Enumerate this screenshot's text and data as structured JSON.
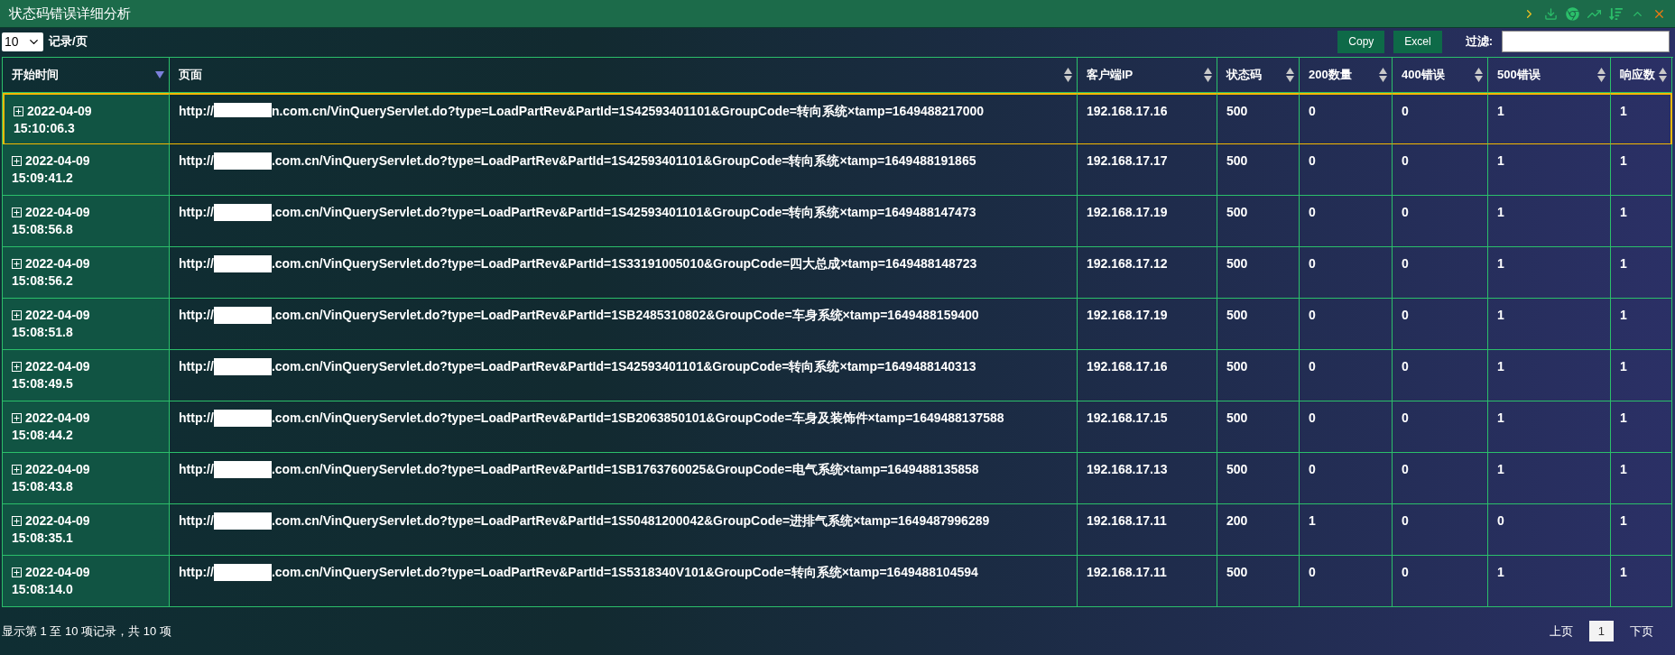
{
  "window": {
    "title": "状态码错误详细分析"
  },
  "toolbar": {
    "page_size": "10",
    "page_size_label": "记录/页",
    "buttons": [
      "Copy",
      "Excel"
    ],
    "filter_label": "过滤:"
  },
  "table": {
    "columns": [
      {
        "label": "开始时间",
        "sorted": true
      },
      {
        "label": "页面",
        "sorted": false
      },
      {
        "label": "客户端IP",
        "sorted": false
      },
      {
        "label": "状态码",
        "sorted": false
      },
      {
        "label": "200数量",
        "sorted": false
      },
      {
        "label": "400错误",
        "sorted": false
      },
      {
        "label": "500错误",
        "sorted": false
      },
      {
        "label": "响应数",
        "sorted": false
      }
    ],
    "rows": [
      {
        "selected": true,
        "date": "2022-04-09",
        "time": "15:10:06.3",
        "page_start": "http://",
        "page_end": "n.com.cn/VinQueryServlet.do?type=LoadPartRev&PartId=1S42593401101&GroupCode=转向系统×tamp=1649488217000",
        "ip": "192.168.17.16",
        "status": "500",
        "c200": "0",
        "c400": "0",
        "c500": "1",
        "resp": "1"
      },
      {
        "selected": false,
        "date": "2022-04-09",
        "time": "15:09:41.2",
        "page_start": "http://",
        "page_end": ".com.cn/VinQueryServlet.do?type=LoadPartRev&PartId=1S42593401101&GroupCode=转向系统×tamp=1649488191865",
        "ip": "192.168.17.17",
        "status": "500",
        "c200": "0",
        "c400": "0",
        "c500": "1",
        "resp": "1"
      },
      {
        "selected": false,
        "date": "2022-04-09",
        "time": "15:08:56.8",
        "page_start": "http://",
        "page_end": ".com.cn/VinQueryServlet.do?type=LoadPartRev&PartId=1S42593401101&GroupCode=转向系统×tamp=1649488147473",
        "ip": "192.168.17.19",
        "status": "500",
        "c200": "0",
        "c400": "0",
        "c500": "1",
        "resp": "1"
      },
      {
        "selected": false,
        "date": "2022-04-09",
        "time": "15:08:56.2",
        "page_start": "http://",
        "page_end": ".com.cn/VinQueryServlet.do?type=LoadPartRev&PartId=1S33191005010&GroupCode=四大总成×tamp=1649488148723",
        "ip": "192.168.17.12",
        "status": "500",
        "c200": "0",
        "c400": "0",
        "c500": "1",
        "resp": "1"
      },
      {
        "selected": false,
        "date": "2022-04-09",
        "time": "15:08:51.8",
        "page_start": "http://",
        "page_end": ".com.cn/VinQueryServlet.do?type=LoadPartRev&PartId=1SB2485310802&GroupCode=车身系统×tamp=1649488159400",
        "ip": "192.168.17.19",
        "status": "500",
        "c200": "0",
        "c400": "0",
        "c500": "1",
        "resp": "1"
      },
      {
        "selected": false,
        "date": "2022-04-09",
        "time": "15:08:49.5",
        "page_start": "http://",
        "page_end": ".com.cn/VinQueryServlet.do?type=LoadPartRev&PartId=1S42593401101&GroupCode=转向系统×tamp=1649488140313",
        "ip": "192.168.17.16",
        "status": "500",
        "c200": "0",
        "c400": "0",
        "c500": "1",
        "resp": "1"
      },
      {
        "selected": false,
        "date": "2022-04-09",
        "time": "15:08:44.2",
        "page_start": "http://",
        "page_end": ".com.cn/VinQueryServlet.do?type=LoadPartRev&PartId=1SB2063850101&GroupCode=车身及装饰件×tamp=1649488137588",
        "ip": "192.168.17.15",
        "status": "500",
        "c200": "0",
        "c400": "0",
        "c500": "1",
        "resp": "1"
      },
      {
        "selected": false,
        "date": "2022-04-09",
        "time": "15:08:43.8",
        "page_start": "http://",
        "page_end": ".com.cn/VinQueryServlet.do?type=LoadPartRev&PartId=1SB1763760025&GroupCode=电气系统×tamp=1649488135858",
        "ip": "192.168.17.13",
        "status": "500",
        "c200": "0",
        "c400": "0",
        "c500": "1",
        "resp": "1"
      },
      {
        "selected": false,
        "date": "2022-04-09",
        "time": "15:08:35.1",
        "page_start": "http://",
        "page_end": ".com.cn/VinQueryServlet.do?type=LoadPartRev&PartId=1S50481200042&GroupCode=进排气系统×tamp=1649487996289",
        "ip": "192.168.17.11",
        "status": "200",
        "c200": "1",
        "c400": "0",
        "c500": "0",
        "resp": "1"
      },
      {
        "selected": false,
        "date": "2022-04-09",
        "time": "15:08:14.0",
        "page_start": "http://",
        "page_end": ".com.cn/VinQueryServlet.do?type=LoadPartRev&PartId=1S5318340V101&GroupCode=转向系统×tamp=1649488104594",
        "ip": "192.168.17.11",
        "status": "500",
        "c200": "0",
        "c400": "0",
        "c500": "1",
        "resp": "1"
      }
    ]
  },
  "footer": {
    "info": "显示第 1 至 10 项记录，共 10 项",
    "pages": [
      {
        "label": "上页",
        "selected": false
      },
      {
        "label": "1",
        "selected": true
      },
      {
        "label": "下页",
        "selected": false
      }
    ]
  }
}
